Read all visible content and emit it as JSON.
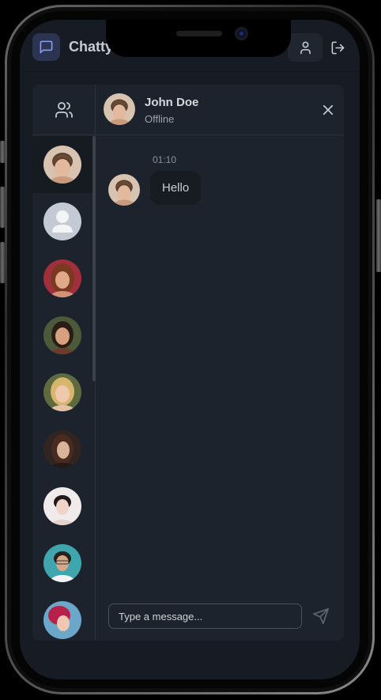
{
  "app": {
    "name": "Chatty"
  },
  "sidebar": {
    "contacts": [
      {
        "name": "John Doe",
        "active": true,
        "avatar": "photo-male-brown-hair"
      },
      {
        "name": "",
        "active": false,
        "avatar": "default-user-placeholder"
      },
      {
        "name": "",
        "active": false,
        "avatar": "photo-female-red-hair"
      },
      {
        "name": "",
        "active": false,
        "avatar": "photo-female-dark-hair"
      },
      {
        "name": "",
        "active": false,
        "avatar": "photo-female-blonde"
      },
      {
        "name": "",
        "active": false,
        "avatar": "photo-female-brunette"
      },
      {
        "name": "",
        "active": false,
        "avatar": "photo-female-dark-hair-light-bg"
      },
      {
        "name": "",
        "active": false,
        "avatar": "photo-female-glasses"
      },
      {
        "name": "",
        "active": false,
        "avatar": "photo-female-pink-hair"
      }
    ]
  },
  "chat": {
    "name": "John Doe",
    "status": "Offline",
    "messages": [
      {
        "time": "01:10",
        "text": "Hello"
      }
    ],
    "input": {
      "placeholder": "Type a message...",
      "value": ""
    }
  },
  "colors": {
    "background": "#171c24",
    "card": "#1d232c",
    "accent": "#2b3552",
    "text": "#c7ccd3"
  }
}
